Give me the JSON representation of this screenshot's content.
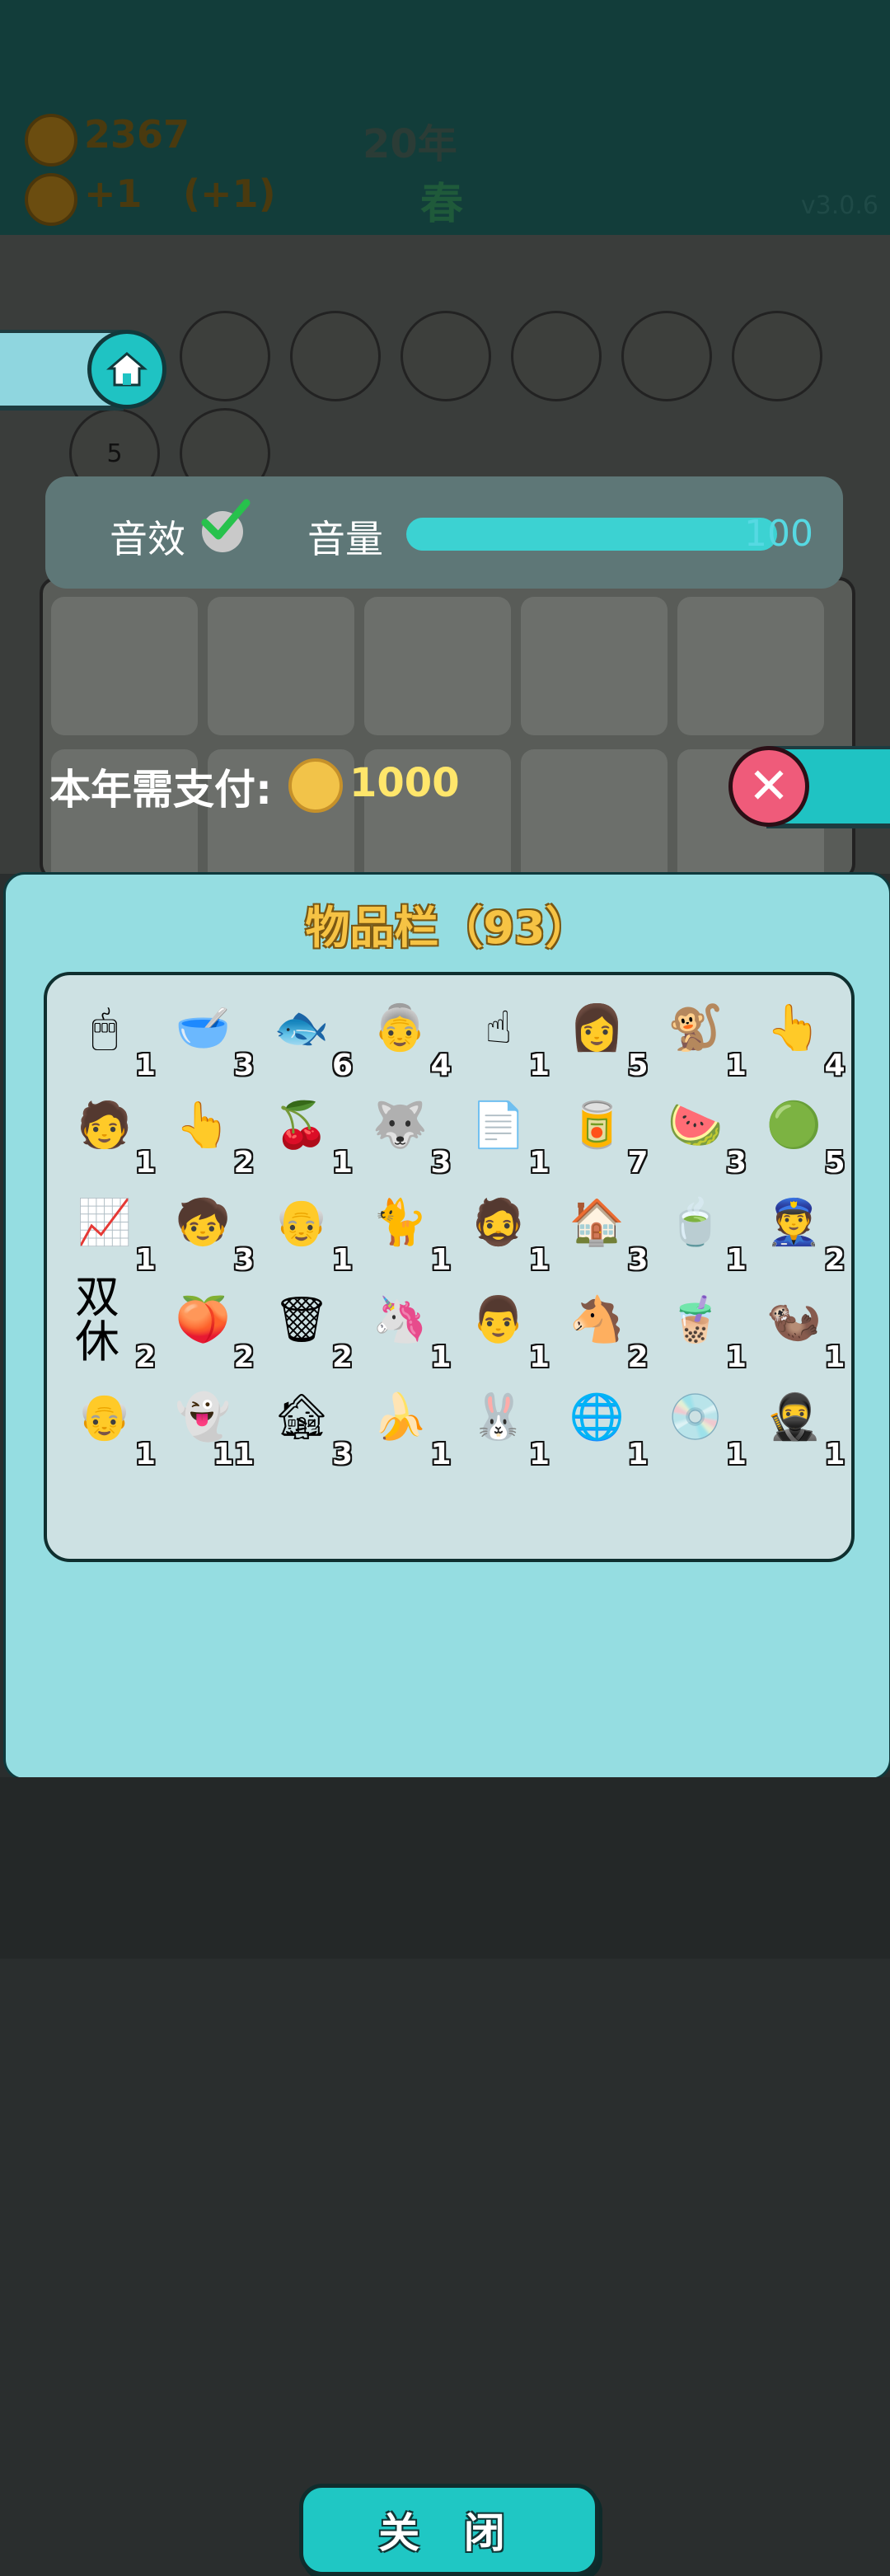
{
  "hud": {
    "coins": "2367",
    "income": "+1",
    "income_bonus": "(+1)",
    "year": "20年",
    "season": "春",
    "version": "v3.0.6"
  },
  "menu_icons": [
    "home-icon",
    "skirt-icon",
    "leaf-icon",
    "skip-icon",
    "plant-icon",
    "ghost-icon",
    "rabbit-icon",
    "calendar-icon",
    "recycle-icon"
  ],
  "calendar_day": "5",
  "settings": {
    "sound_label": "音效",
    "sound_enabled": true,
    "volume_label": "音量",
    "volume_value": "100",
    "volume_fraction": 1.0
  },
  "payment": {
    "label": "本年需支付:",
    "amount": "1000"
  },
  "inventory": {
    "title": "物品栏（93）",
    "items": [
      {
        "icon": "mouse-icon",
        "glyph": "🖱",
        "count": "1"
      },
      {
        "icon": "bowl-icon",
        "glyph": "🥣",
        "count": "3"
      },
      {
        "icon": "koi-fish-icon",
        "glyph": "🐟",
        "count": "6"
      },
      {
        "icon": "grandma-icon",
        "glyph": "👵",
        "count": "4"
      },
      {
        "icon": "pointing-hand-icon",
        "glyph": "☝",
        "count": "1"
      },
      {
        "icon": "girl-icon",
        "glyph": "👩",
        "count": "5"
      },
      {
        "icon": "monkey-icon",
        "glyph": "🐒",
        "count": "1"
      },
      {
        "icon": "gold-hand-icon",
        "glyph": "👆",
        "count": "4"
      },
      {
        "icon": "green-cap-man-icon",
        "glyph": "🧑",
        "count": "1"
      },
      {
        "icon": "brown-hand-icon",
        "glyph": "👆",
        "count": "2"
      },
      {
        "icon": "cherry-icon",
        "glyph": "🍒",
        "count": "1"
      },
      {
        "icon": "husky-icon",
        "glyph": "🐺",
        "count": "3"
      },
      {
        "icon": "copy-paste-icon",
        "glyph": "📄",
        "count": "1"
      },
      {
        "icon": "jar-icon",
        "glyph": "🥫",
        "count": "7"
      },
      {
        "icon": "watermelon-slice-icon",
        "glyph": "🍉",
        "count": "3"
      },
      {
        "icon": "watermelon-icon",
        "glyph": "🟢",
        "count": "5"
      },
      {
        "icon": "stock-chart-icon",
        "glyph": "📈",
        "count": "1"
      },
      {
        "icon": "glasses-boy-icon",
        "glyph": "🧒",
        "count": "3"
      },
      {
        "icon": "old-man-cap-icon",
        "glyph": "👴",
        "count": "1"
      },
      {
        "icon": "cat-icon",
        "glyph": "🐈",
        "count": "1"
      },
      {
        "icon": "bald-man-icon",
        "glyph": "🧔",
        "count": "1"
      },
      {
        "icon": "bunny-house-icon",
        "glyph": "🏠",
        "count": "3"
      },
      {
        "icon": "tea-bag-icon",
        "glyph": "🍵",
        "count": "1"
      },
      {
        "icon": "police-icon",
        "glyph": "👮",
        "count": "2"
      },
      {
        "icon": "weekend-icon",
        "glyph": "双休",
        "count": "2"
      },
      {
        "icon": "peach-icon",
        "glyph": "🍑",
        "count": "2"
      },
      {
        "icon": "garbage-bag-icon",
        "glyph": "🗑",
        "count": "2"
      },
      {
        "icon": "unicorn-icon",
        "glyph": "🦄",
        "count": "1"
      },
      {
        "icon": "farmer-icon",
        "glyph": "👨",
        "count": "1"
      },
      {
        "icon": "horse-icon",
        "glyph": "🐴",
        "count": "2"
      },
      {
        "icon": "bubble-tea-icon",
        "glyph": "🧋",
        "count": "1"
      },
      {
        "icon": "otter-icon",
        "glyph": "🦦",
        "count": "1"
      },
      {
        "icon": "grandpa-glasses-icon",
        "glyph": "👴",
        "count": "1"
      },
      {
        "icon": "ghost-icon",
        "glyph": "👻",
        "count": "11"
      },
      {
        "icon": "haunted-house-icon",
        "glyph": "🏚",
        "count": "3"
      },
      {
        "icon": "banana-icon",
        "glyph": "🍌",
        "count": "1"
      },
      {
        "icon": "rabbit-book-icon",
        "glyph": "🐰",
        "count": "1"
      },
      {
        "icon": "globe-icon",
        "glyph": "🌐",
        "count": "1"
      },
      {
        "icon": "cd-icon",
        "glyph": "💿",
        "count": "1"
      },
      {
        "icon": "bandit-icon",
        "glyph": "🥷",
        "count": "1"
      }
    ]
  },
  "close_label": "关 闭",
  "colors": {
    "panel": "#95dde1",
    "accent": "#1fc7c4",
    "title": "#f6c344",
    "close_x": "#ef5b7a"
  }
}
